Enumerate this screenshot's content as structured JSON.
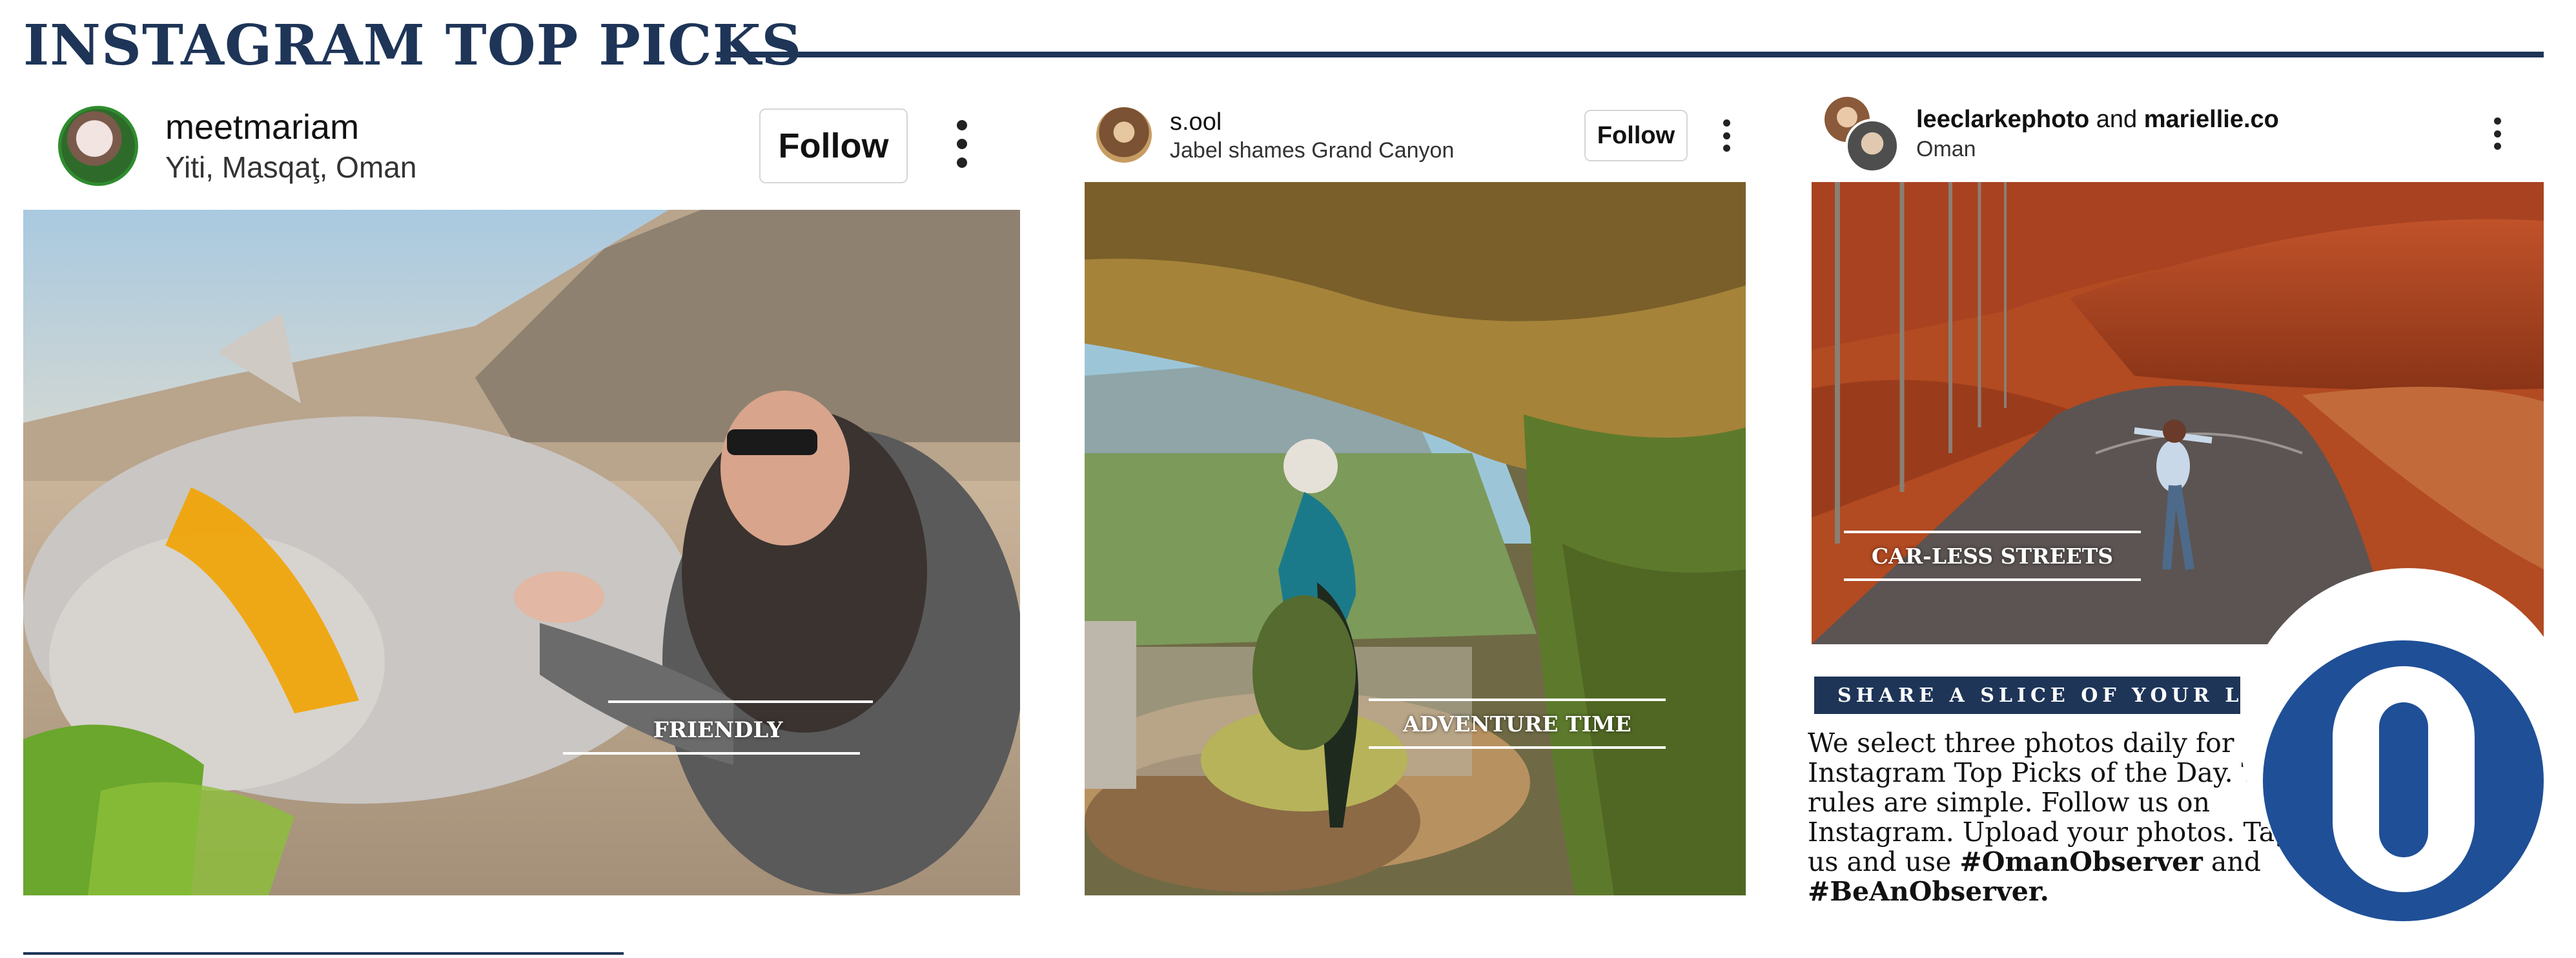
{
  "page": {
    "title": "INSTAGRAM TOP PICKS"
  },
  "posts": [
    {
      "username": "meetmariam",
      "location": "Yiti, Masqaţ, Oman",
      "follow_label": "Follow",
      "caption": "FRIENDLY"
    },
    {
      "username": "s.ool",
      "location": "Jabel shames Grand Canyon",
      "follow_label": "Follow",
      "caption": "ADVENTURE TIME"
    },
    {
      "username_primary": "leeclarkephoto",
      "username_joiner": "and",
      "username_secondary": "mariellie.co",
      "location": "Oman",
      "caption": "CAR-LESS STREETS"
    }
  ],
  "share": {
    "banner": "SHARE A SLICE OF YOUR LIFE",
    "body": "We select three photos daily for our Instagram Top Picks of the Day. The rules are simple. Follow us on Instagram. Upload your photos. Tag us and use",
    "hashtag_1": "#OmanObserver",
    "joiner": "and",
    "hashtag_2": "#BeAnObserver."
  },
  "colors": {
    "brand_navy": "#1e3558",
    "logo_blue": "#1f4f97"
  },
  "icons": [
    "more-vertical-icon",
    "avatar-photo",
    "observer-logo"
  ]
}
